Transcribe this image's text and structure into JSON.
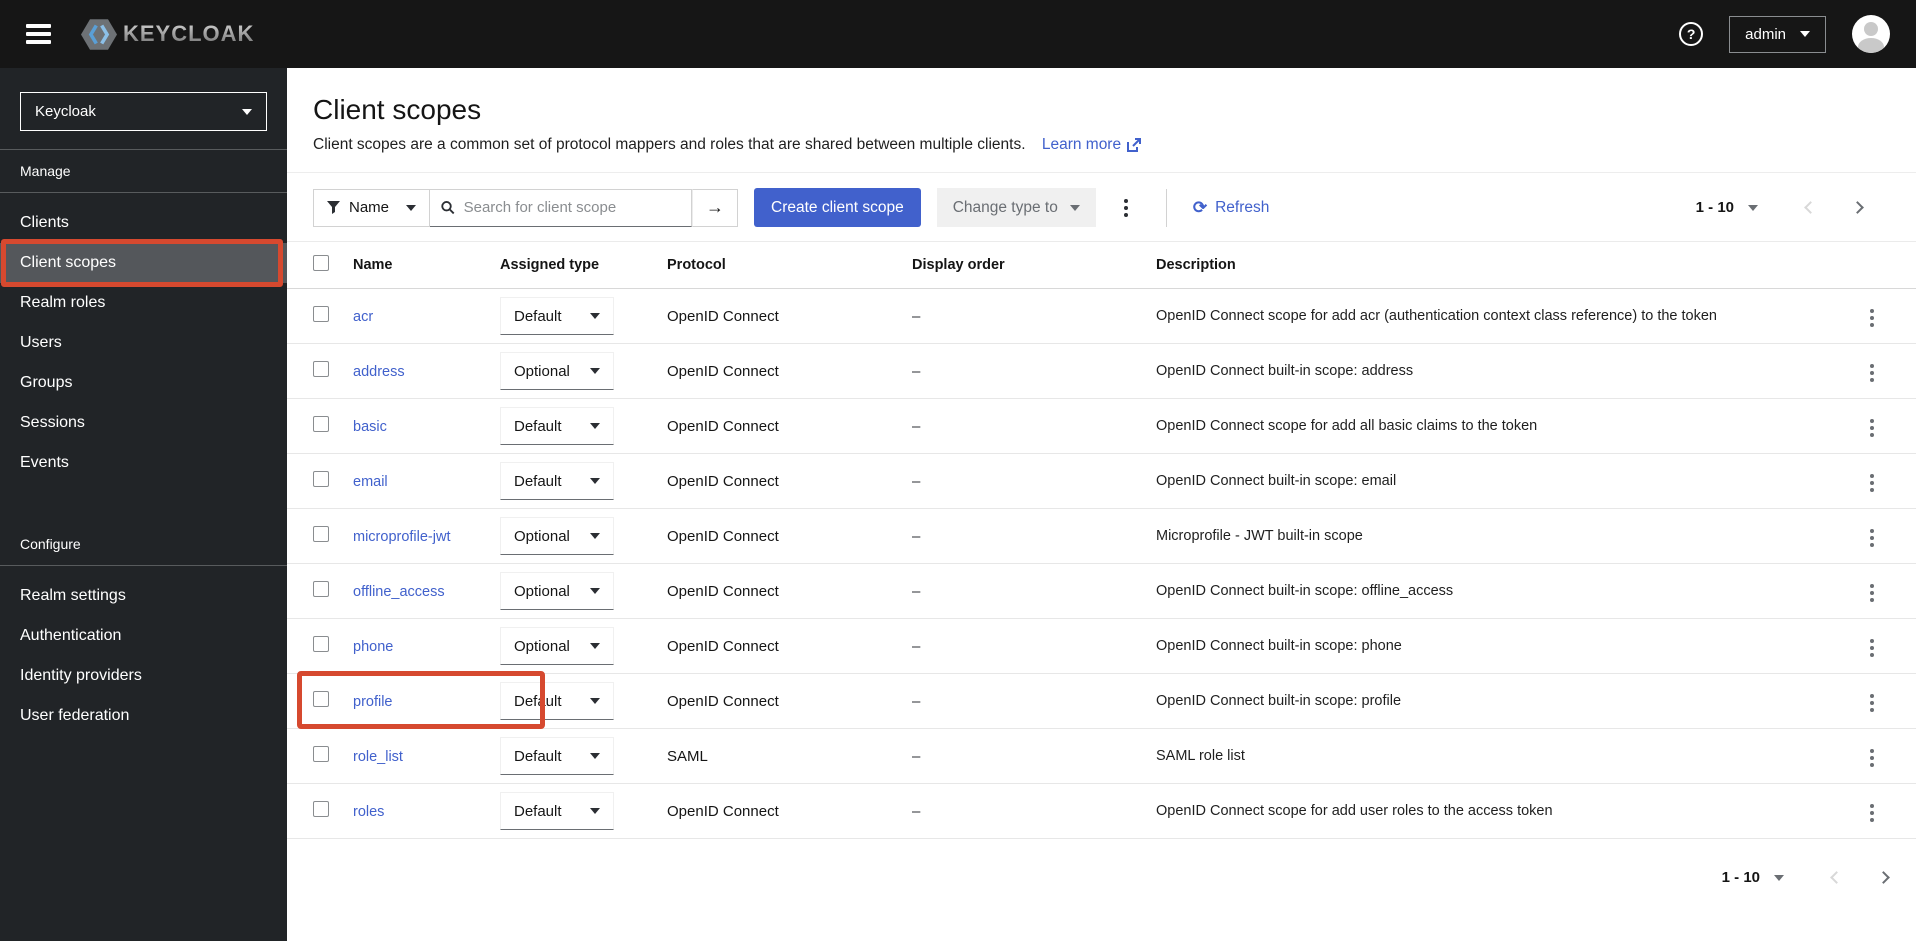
{
  "masthead": {
    "brand": "KEYCLOAK",
    "username": "admin"
  },
  "icons": {
    "help_glyph": "?",
    "arrow_glyph": "→",
    "refresh_glyph": "⟳"
  },
  "sidebar": {
    "realm_select": "Keycloak",
    "sections": [
      {
        "label": "Manage",
        "items": [
          {
            "label": "Clients"
          },
          {
            "label": "Client scopes",
            "active": true,
            "annotated": true
          },
          {
            "label": "Realm roles"
          },
          {
            "label": "Users"
          },
          {
            "label": "Groups"
          },
          {
            "label": "Sessions"
          },
          {
            "label": "Events"
          }
        ]
      },
      {
        "label": "Configure",
        "items": [
          {
            "label": "Realm settings"
          },
          {
            "label": "Authentication"
          },
          {
            "label": "Identity providers"
          },
          {
            "label": "User federation"
          }
        ]
      }
    ]
  },
  "page": {
    "title": "Client scopes",
    "description": "Client scopes are a common set of protocol mappers and roles that are shared between multiple clients.",
    "learn_more_label": "Learn more"
  },
  "toolbar": {
    "filter_label": "Name",
    "search_placeholder": "Search for client scope",
    "create_button_label": "Create client scope",
    "change_type_label": "Change type to",
    "refresh_label": "Refresh",
    "pagination_range": "1 - 10"
  },
  "table": {
    "columns": [
      "Name",
      "Assigned type",
      "Protocol",
      "Display order",
      "Description"
    ],
    "rows": [
      {
        "name": "acr",
        "type": "Default",
        "protocol": "OpenID Connect",
        "display_order": "–",
        "description": "OpenID Connect scope for add acr (authentication context class reference) to the token"
      },
      {
        "name": "address",
        "type": "Optional",
        "protocol": "OpenID Connect",
        "display_order": "–",
        "description": "OpenID Connect built-in scope: address"
      },
      {
        "name": "basic",
        "type": "Default",
        "protocol": "OpenID Connect",
        "display_order": "–",
        "description": "OpenID Connect scope for add all basic claims to the token"
      },
      {
        "name": "email",
        "type": "Default",
        "protocol": "OpenID Connect",
        "display_order": "–",
        "description": "OpenID Connect built-in scope: email"
      },
      {
        "name": "microprofile-jwt",
        "type": "Optional",
        "protocol": "OpenID Connect",
        "display_order": "–",
        "description": "Microprofile - JWT built-in scope"
      },
      {
        "name": "offline_access",
        "type": "Optional",
        "protocol": "OpenID Connect",
        "display_order": "–",
        "description": "OpenID Connect built-in scope: offline_access"
      },
      {
        "name": "phone",
        "type": "Optional",
        "protocol": "OpenID Connect",
        "display_order": "–",
        "description": "OpenID Connect built-in scope: phone"
      },
      {
        "name": "profile",
        "type": "Default",
        "protocol": "OpenID Connect",
        "display_order": "–",
        "description": "OpenID Connect built-in scope: profile",
        "annotated": true
      },
      {
        "name": "role_list",
        "type": "Default",
        "protocol": "SAML",
        "display_order": "–",
        "description": "SAML role list"
      },
      {
        "name": "roles",
        "type": "Default",
        "protocol": "OpenID Connect",
        "display_order": "–",
        "description": "OpenID Connect scope for add user roles to the access token"
      }
    ]
  },
  "footer": {
    "pagination_range": "1 - 10"
  },
  "colors": {
    "accent": "#4161cc",
    "annotation": "#d6492f",
    "masthead_bg": "#161616",
    "sidebar_bg": "#212427"
  }
}
